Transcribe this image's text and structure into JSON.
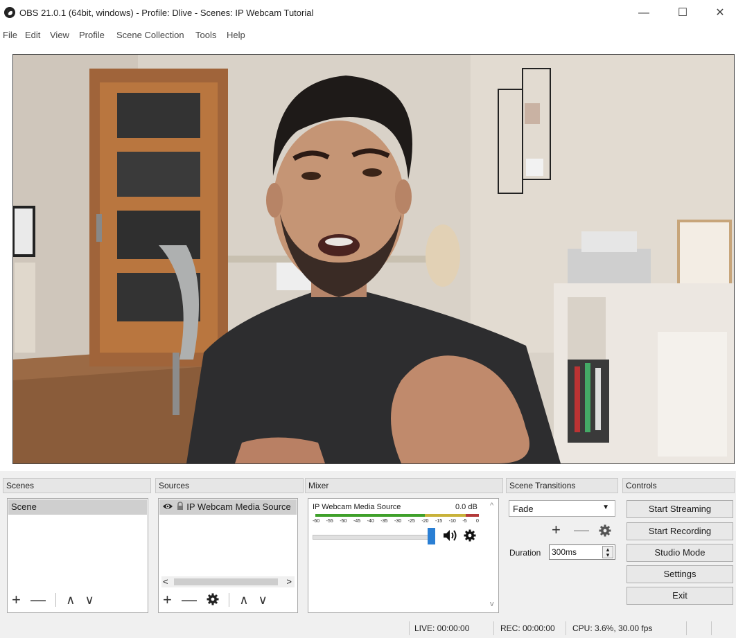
{
  "window": {
    "title": "OBS 21.0.1 (64bit, windows) - Profile: Dlive - Scenes: IP Webcam Tutorial",
    "app_icon": "obs-logo-icon",
    "controls": [
      "minimize-icon",
      "maximize-icon",
      "close-icon"
    ],
    "minimize_glyph": "—",
    "maximize_glyph": "☐",
    "close_glyph": "✕"
  },
  "menu": [
    "File",
    "Edit",
    "View",
    "Profile",
    "Scene Collection",
    "Tools",
    "Help"
  ],
  "docks": {
    "scenes": "Scenes",
    "sources": "Sources",
    "mixer": "Mixer",
    "transitions": "Scene Transitions",
    "controls": "Controls"
  },
  "scenes": {
    "items": [
      "Scene"
    ],
    "controls": {
      "add": "+",
      "remove": "—",
      "up": "∧",
      "down": "∨"
    }
  },
  "sources": {
    "items": [
      {
        "name": "IP Webcam Media Source",
        "visible_icon": "eye-icon",
        "lock_icon": "lock-icon"
      }
    ],
    "scroll_left": "<",
    "scroll_right": ">",
    "controls": {
      "add": "+",
      "remove": "—",
      "properties": "gear-icon",
      "up": "∧",
      "down": "∨"
    }
  },
  "mixer": {
    "channel": "IP Webcam Media Source",
    "level": "0.0 dB",
    "scale": [
      "-60",
      "-55",
      "-50",
      "-45",
      "-40",
      "-35",
      "-30",
      "-25",
      "-20",
      "-15",
      "-10",
      "-5",
      "0"
    ],
    "volume_fraction": 1.0
  },
  "transitions": {
    "selected": "Fade",
    "duration_label": "Duration",
    "duration_value": "300ms"
  },
  "controls": {
    "start_streaming": "Start Streaming",
    "start_recording": "Start Recording",
    "studio_mode": "Studio Mode",
    "settings": "Settings",
    "exit": "Exit"
  },
  "status": {
    "live": "LIVE: 00:00:00",
    "rec": "REC: 00:00:00",
    "cpu": "CPU: 3.6%, 30.00 fps"
  },
  "colors": {
    "meter_green": "#3fa02a",
    "meter_yellow": "#c8b23a",
    "meter_red": "#b33a3a",
    "slider_handle": "#2a7fd4"
  }
}
